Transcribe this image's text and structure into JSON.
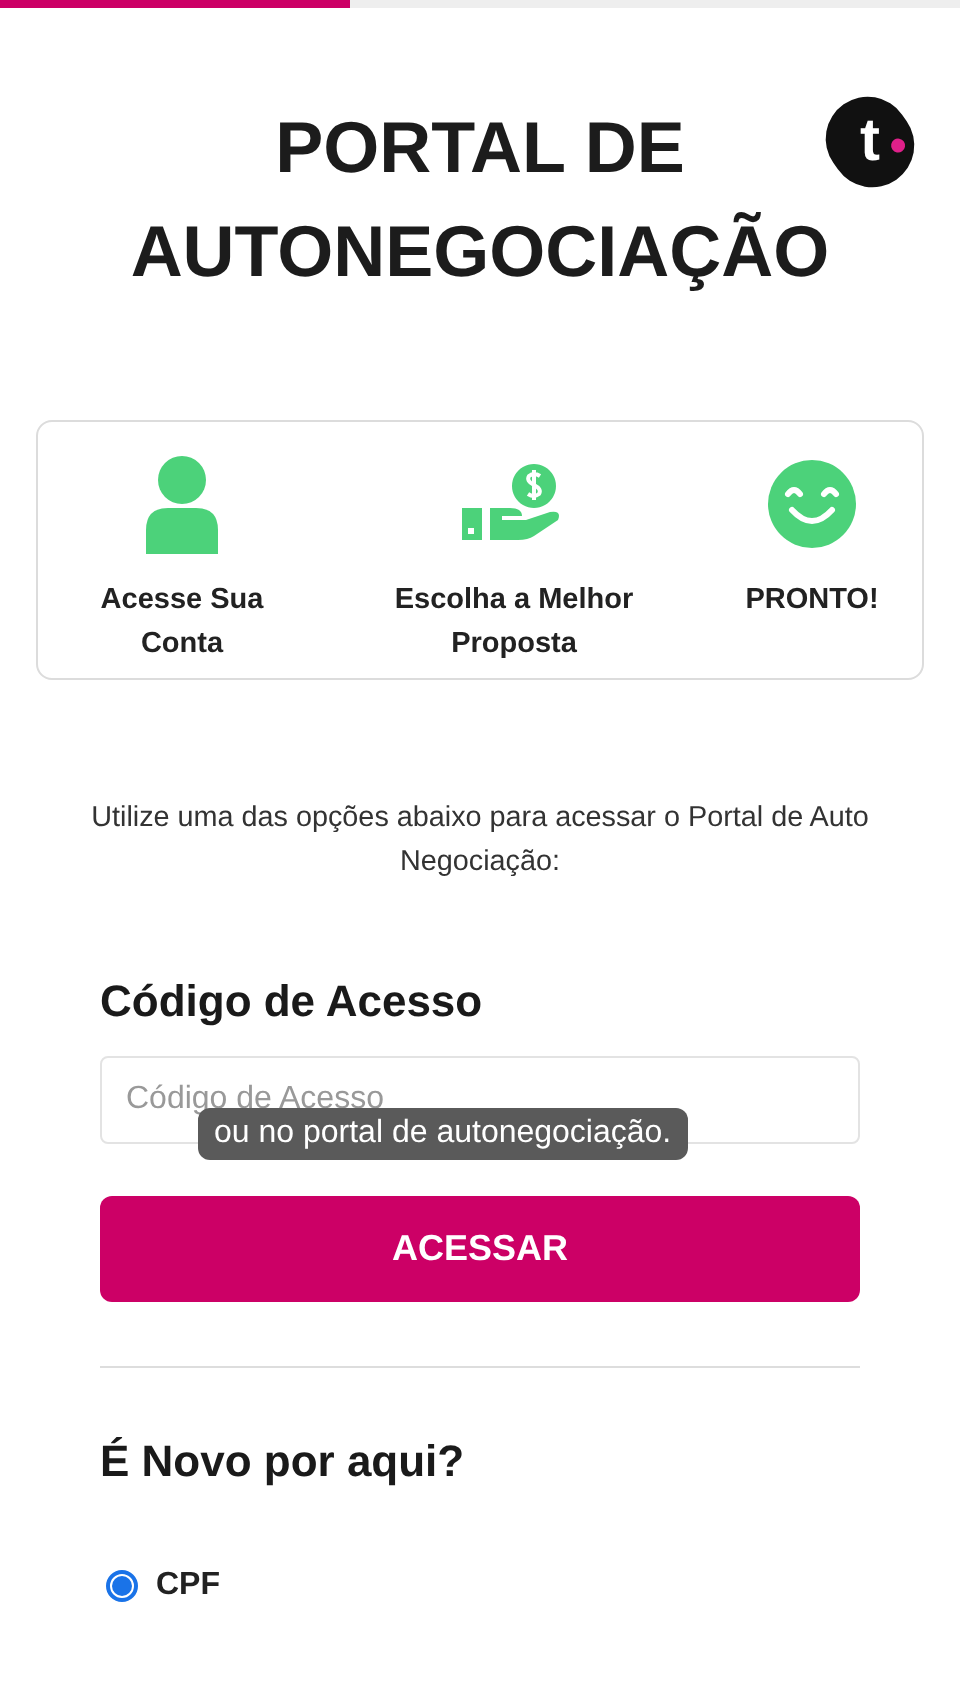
{
  "video_progress": {
    "level": 0.365
  },
  "logo": {
    "letter": "t"
  },
  "title": [
    "PORTAL DE",
    "AUTONEGOCIAÇÃO"
  ],
  "steps": [
    {
      "kind": "user",
      "label": "Acesse Sua Conta"
    },
    {
      "kind": "money",
      "label": "Escolha a Melhor Proposta"
    },
    {
      "kind": "smile",
      "label": "PRONTO!"
    }
  ],
  "instructions": "Utilize uma das opções abaixo para acessar o Portal de Auto Negociação:",
  "access_section": {
    "heading": "Código de Acesso",
    "placeholder": "Código de Acesso",
    "button": "ACESSAR"
  },
  "caption": "ou no portal de autonegociação.",
  "new_section": {
    "heading": "É Novo por aqui?",
    "options": [
      {
        "label": "CPF",
        "selected": true
      }
    ]
  }
}
